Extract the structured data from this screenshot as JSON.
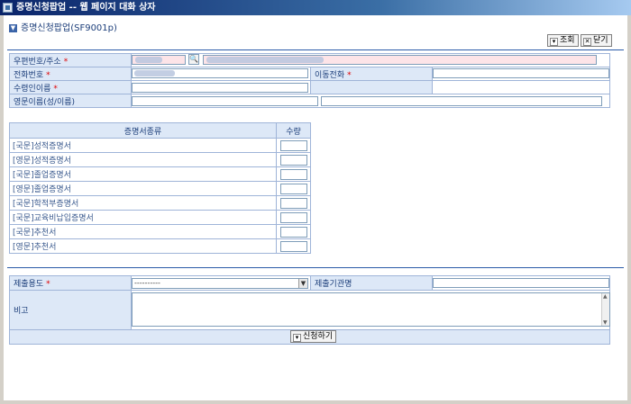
{
  "window": {
    "title": "증명신청팝업 -- 웹 페이지 대화 상자"
  },
  "page": {
    "title": "증명신청팝업(SF9001p)"
  },
  "toolbar": {
    "search_label": "조회",
    "close_label": "닫기"
  },
  "applicant": {
    "zip_label": "우편번호/주소",
    "phone_label": "전화번호",
    "mobile_label": "이동전화",
    "recipient_label": "수령인이름",
    "english_name_label": "영문이름(성/이름)",
    "required_mark": "*"
  },
  "certificates": {
    "header_type": "증명서종류",
    "header_qty": "수량",
    "rows": [
      "[국문]성적증명서",
      "[영문]성적증명서",
      "[국문]졸업증명서",
      "[영문]졸업증명서",
      "[국문]학적부증명서",
      "[국문]교육비납입증명서",
      "[국문]추천서",
      "[영문]추천서"
    ]
  },
  "submission": {
    "purpose_label": "제출용도",
    "purpose_value": "----------",
    "institution_label": "제출기관명",
    "remarks_label": "비고",
    "apply_label": "신청하기"
  },
  "icons": {
    "window": "app-icon",
    "section": "collapse-triangle-icon",
    "search": "search-icon",
    "close": "close-icon",
    "apply": "apply-icon",
    "dropdown": "chevron-down-icon"
  }
}
